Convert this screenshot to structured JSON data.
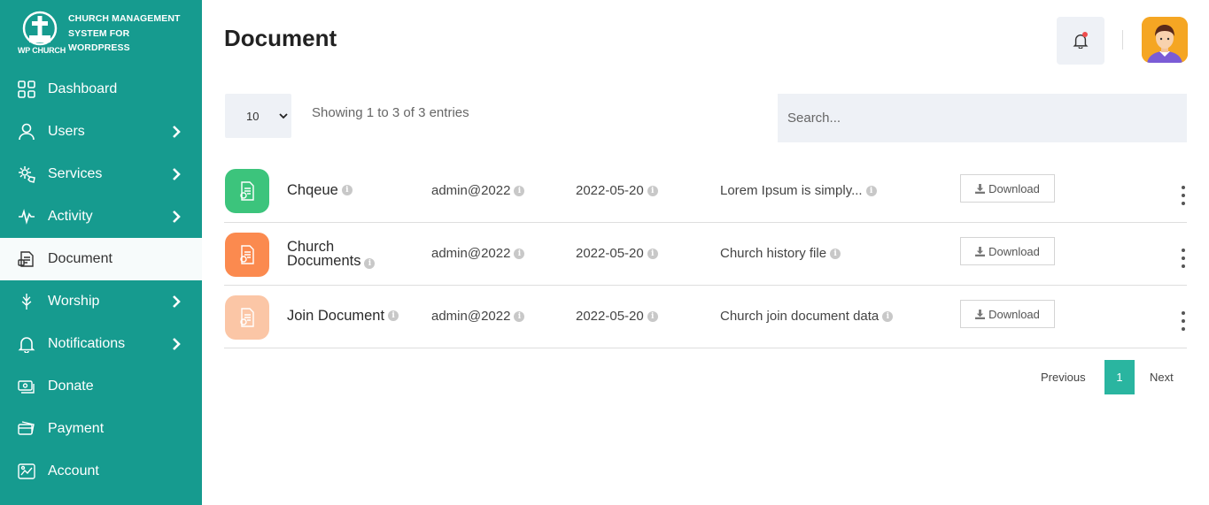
{
  "brand": {
    "logo_text": "WP CHURCH",
    "title": "CHURCH MANAGEMENT SYSTEM FOR WORDPRESS"
  },
  "sidebar": {
    "items": [
      {
        "label": "Dashboard",
        "icon": "dashboard-icon",
        "chevron": false,
        "active": false
      },
      {
        "label": "Users",
        "icon": "user-icon",
        "chevron": true,
        "active": false
      },
      {
        "label": "Services",
        "icon": "services-icon",
        "chevron": true,
        "active": false
      },
      {
        "label": "Activity",
        "icon": "activity-icon",
        "chevron": true,
        "active": false
      },
      {
        "label": "Document",
        "icon": "document-icon",
        "chevron": false,
        "active": true
      },
      {
        "label": "Worship",
        "icon": "worship-icon",
        "chevron": true,
        "active": false
      },
      {
        "label": "Notifications",
        "icon": "bell-icon",
        "chevron": true,
        "active": false
      },
      {
        "label": "Donate",
        "icon": "donate-icon",
        "chevron": false,
        "active": false
      },
      {
        "label": "Payment",
        "icon": "payment-icon",
        "chevron": false,
        "active": false
      },
      {
        "label": "Account",
        "icon": "account-icon",
        "chevron": false,
        "active": false
      }
    ]
  },
  "header": {
    "title": "Document"
  },
  "table_controls": {
    "page_length": "10",
    "info": "Showing 1 to 3 of 3 entries",
    "search_placeholder": "Search..."
  },
  "rows": [
    {
      "name": "Chqeue",
      "name_line2": "",
      "user": "admin@2022",
      "date": "2022-05-20",
      "description": "Lorem Ipsum is simply...",
      "download_label": "Download",
      "icon_color": "#3cc47c"
    },
    {
      "name": "Church",
      "name_line2": "Documents",
      "user": "admin@2022",
      "date": "2022-05-20",
      "description": "Church history file",
      "download_label": "Download",
      "icon_color": "#fb8a4f"
    },
    {
      "name": "Join Document",
      "name_line2": "",
      "user": "admin@2022",
      "date": "2022-05-20",
      "description": "Church join document data",
      "download_label": "Download",
      "icon_color": "#fbc6a6"
    }
  ],
  "pagination": {
    "previous": "Previous",
    "current": "1",
    "next": "Next"
  },
  "colors": {
    "sidebar": "#169b8f",
    "accent": "#2ab5a0"
  }
}
